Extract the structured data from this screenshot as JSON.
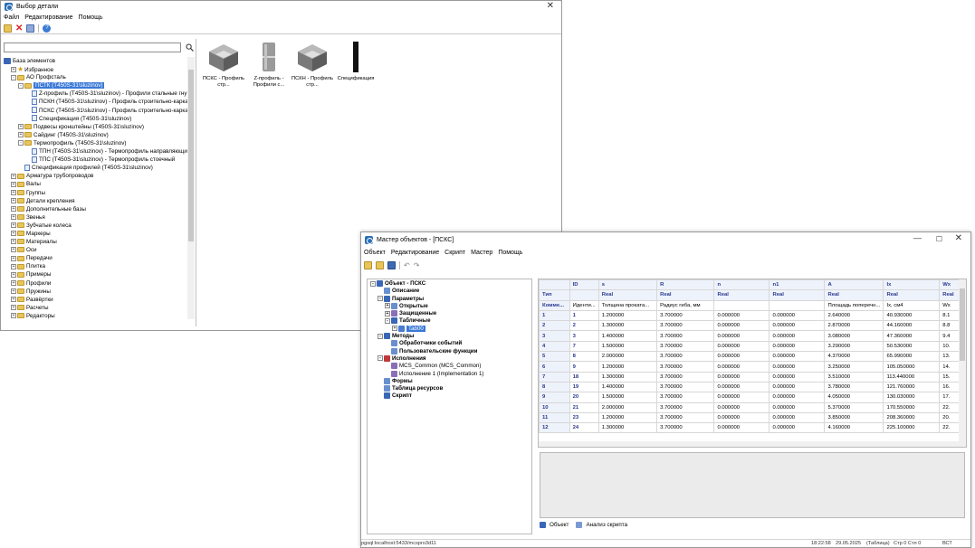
{
  "win1": {
    "title": "Выбор детали",
    "menu": [
      "Файл",
      "Редактирование",
      "Помощь"
    ],
    "search": {
      "value": "",
      "placeholder": ""
    },
    "tree": [
      {
        "label": "База элементов",
        "level": 0,
        "icon": "db"
      },
      {
        "label": "Избранное",
        "level": 1,
        "icon": "star",
        "exp": "+"
      },
      {
        "label": "АО Профсталь",
        "level": 1,
        "icon": "folder",
        "exp": "-"
      },
      {
        "label": "ПСТК (T450S-31\\sluzinov)",
        "level": 2,
        "icon": "folder",
        "exp": "-",
        "selected": true
      },
      {
        "label": "Z-профиль (T450S-31\\sluzinov) - Профили стальные гну",
        "level": 3,
        "icon": "doc"
      },
      {
        "label": "ПСКН (T450S-31\\sluzinov) - Профиль строительно-карка",
        "level": 3,
        "icon": "doc"
      },
      {
        "label": "ПСКС (T450S-31\\sluzinov) - Профиль строительно-карка",
        "level": 3,
        "icon": "doc"
      },
      {
        "label": "Спецификация (T450S-31\\sluzinov)",
        "level": 3,
        "icon": "doc"
      },
      {
        "label": "Подвесы кронштейны (T450S-31\\sluzinov)",
        "level": 2,
        "icon": "folder",
        "exp": "+"
      },
      {
        "label": "Сайдинг (T450S-31\\sluzinov)",
        "level": 2,
        "icon": "folder",
        "exp": "+"
      },
      {
        "label": "Термопрофиль (T450S-31\\sluzinov)",
        "level": 2,
        "icon": "folder",
        "exp": "-"
      },
      {
        "label": "ТПН (T450S-31\\sluzinov) - Термопрофиль направляющи",
        "level": 3,
        "icon": "doc"
      },
      {
        "label": "ТПС (T450S-31\\sluzinov) - Термопрофиль стоечный",
        "level": 3,
        "icon": "doc"
      },
      {
        "label": "Спецификация профилей (T450S-31\\sluzinov)",
        "level": 2,
        "icon": "doc"
      },
      {
        "label": "Арматура трубопроводов",
        "level": 1,
        "icon": "folder",
        "exp": "+"
      },
      {
        "label": "Валы",
        "level": 1,
        "icon": "folder",
        "exp": "+"
      },
      {
        "label": "Группы",
        "level": 1,
        "icon": "folder",
        "exp": "+"
      },
      {
        "label": "Детали крепления",
        "level": 1,
        "icon": "folder",
        "exp": "+"
      },
      {
        "label": "Дополнительные базы",
        "level": 1,
        "icon": "folder",
        "exp": "+"
      },
      {
        "label": "Звенья",
        "level": 1,
        "icon": "folder",
        "exp": "+"
      },
      {
        "label": "Зубчатые колеса",
        "level": 1,
        "icon": "folder",
        "exp": "+"
      },
      {
        "label": "Маркеры",
        "level": 1,
        "icon": "folder",
        "exp": "+"
      },
      {
        "label": "Материалы",
        "level": 1,
        "icon": "folder",
        "exp": "+"
      },
      {
        "label": "Оси",
        "level": 1,
        "icon": "folder",
        "exp": "+"
      },
      {
        "label": "Передачи",
        "level": 1,
        "icon": "folder",
        "exp": "+"
      },
      {
        "label": "Плитка",
        "level": 1,
        "icon": "folder",
        "exp": "+"
      },
      {
        "label": "Примеры",
        "level": 1,
        "icon": "folder",
        "exp": "+"
      },
      {
        "label": "Профили",
        "level": 1,
        "icon": "folder",
        "exp": "+"
      },
      {
        "label": "Пружины",
        "level": 1,
        "icon": "folder",
        "exp": "+"
      },
      {
        "label": "Развёртки",
        "level": 1,
        "icon": "folder",
        "exp": "+"
      },
      {
        "label": "Расчеты",
        "level": 1,
        "icon": "folder",
        "exp": "+"
      },
      {
        "label": "Редакторы",
        "level": 1,
        "icon": "folder",
        "exp": "+"
      }
    ],
    "tiles": [
      {
        "label": "ПСКС - Профиль стр...",
        "shape": "channel-profile"
      },
      {
        "label": "Z-профиль - Профили с...",
        "shape": "z-profile"
      },
      {
        "label": "ПСКН - Профиль стр...",
        "shape": "channel-profile"
      },
      {
        "label": "Спецификация",
        "shape": "black-bar"
      }
    ]
  },
  "win2": {
    "title": "Мастер объектов - [ПСКС]",
    "menu": [
      "Объект",
      "Редактирование",
      "Скрипт",
      "Мастер",
      "Помощь"
    ],
    "tree": [
      {
        "label": "Объект - ПСКС",
        "level": 0,
        "bold": true,
        "exp": "-",
        "icon": "object"
      },
      {
        "label": "Описание",
        "level": 1,
        "bold": true
      },
      {
        "label": "Параметры",
        "level": 1,
        "bold": true,
        "exp": "-"
      },
      {
        "label": "Открытые",
        "level": 2,
        "bold": true,
        "exp": "+"
      },
      {
        "label": "Защищенные",
        "level": 2,
        "bold": true,
        "exp": "+"
      },
      {
        "label": "Табличные",
        "level": 2,
        "bold": true,
        "exp": "-"
      },
      {
        "label": "Tab00",
        "level": 3,
        "selected": true,
        "exp": "+"
      },
      {
        "label": "Методы",
        "level": 1,
        "bold": true,
        "exp": "-"
      },
      {
        "label": "Обработчики событий",
        "level": 2,
        "bold": true
      },
      {
        "label": "Пользовательские функции",
        "level": 2,
        "bold": true
      },
      {
        "label": "Исполнения",
        "level": 1,
        "bold": true,
        "exp": "-"
      },
      {
        "label": "MCS_Common (MCS_Common)",
        "level": 2
      },
      {
        "label": "Исполнение 1 (Implementation 1)",
        "level": 2
      },
      {
        "label": "Формы",
        "level": 1,
        "bold": true
      },
      {
        "label": "Таблица ресурсов",
        "level": 1,
        "bold": true
      },
      {
        "label": "Скрипт",
        "level": 1,
        "bold": true
      }
    ],
    "grid": {
      "columns": [
        "",
        "ID",
        "s",
        "R",
        "n",
        "n1",
        "A",
        "Ix",
        "Wx"
      ],
      "type_row": [
        "Тип",
        "",
        "Real",
        "Real",
        "Real",
        "Real",
        "Real",
        "Real",
        "Real"
      ],
      "comment_row": [
        "Комме...",
        "Иденти...",
        "Толщина проката...",
        "Радиус гиба, мм",
        "",
        "",
        "Площадь поперечн...",
        "Ix, см4",
        "Wx"
      ],
      "rows": [
        [
          "1",
          "1",
          "1.200000",
          "3.700000",
          "0.000000",
          "0.000000",
          "2.640000",
          "40.930000",
          "8.1"
        ],
        [
          "2",
          "2",
          "1.300000",
          "3.700000",
          "0.000000",
          "0.000000",
          "2.870000",
          "44.160000",
          "8.8"
        ],
        [
          "3",
          "3",
          "1.400000",
          "3.700000",
          "0.000000",
          "0.000000",
          "3.080000",
          "47.360000",
          "9.4"
        ],
        [
          "4",
          "7",
          "1.500000",
          "3.700000",
          "0.000000",
          "0.000000",
          "3.290000",
          "50.530000",
          "10."
        ],
        [
          "5",
          "8",
          "2.000000",
          "3.700000",
          "0.000000",
          "0.000000",
          "4.370000",
          "65.990000",
          "13."
        ],
        [
          "6",
          "9",
          "1.200000",
          "3.700000",
          "0.000000",
          "0.000000",
          "3.250000",
          "105.050000",
          "14."
        ],
        [
          "7",
          "18",
          "1.300000",
          "3.700000",
          "0.000000",
          "0.000000",
          "3.510000",
          "113.440000",
          "15."
        ],
        [
          "8",
          "19",
          "1.400000",
          "3.700000",
          "0.000000",
          "0.000000",
          "3.780000",
          "121.760000",
          "16."
        ],
        [
          "9",
          "20",
          "1.500000",
          "3.700000",
          "0.000000",
          "0.000000",
          "4.050000",
          "130.030000",
          "17."
        ],
        [
          "10",
          "21",
          "2.000000",
          "3.700000",
          "0.000000",
          "0.000000",
          "5.370000",
          "170.550000",
          "22."
        ],
        [
          "11",
          "23",
          "1.200000",
          "3.700000",
          "0.000000",
          "0.000000",
          "3.850000",
          "208.360000",
          "20."
        ],
        [
          "12",
          "24",
          "1.300000",
          "3.700000",
          "0.000000",
          "0.000000",
          "4.160000",
          "225.100000",
          "22."
        ]
      ]
    },
    "tabs": [
      "Объект",
      "Анализ скрипта"
    ],
    "status": {
      "left": "pgsql:localhost:5433/mcspro3d11",
      "time": "18:22:58",
      "date": "29.05.2025",
      "mode": "(Таблица)",
      "pos": "Стр 0 Стл 0",
      "ins": "ВСТ"
    }
  },
  "colors": {
    "selection": "#3a78d7",
    "grid_header": "#eef2fb",
    "grid_header_text": "#2a3a8f",
    "bottom_panel": "#ebebeb"
  }
}
